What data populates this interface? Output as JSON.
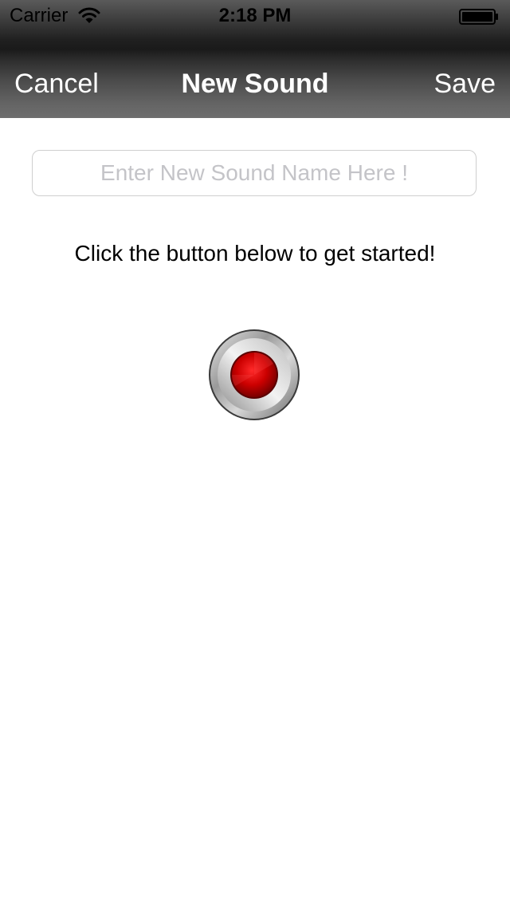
{
  "status_bar": {
    "carrier": "Carrier",
    "time": "2:18 PM",
    "wifi_icon": "wifi-icon",
    "battery_icon": "battery-icon"
  },
  "nav": {
    "cancel_label": "Cancel",
    "title": "New Sound",
    "save_label": "Save"
  },
  "sound_name": {
    "value": "",
    "placeholder": "Enter New Sound Name Here !"
  },
  "instruction": "Click the button below to get started!",
  "record_button": {
    "icon": "record-icon",
    "accent_color": "#cc0000"
  },
  "colors": {
    "nav_text": "#ffffff",
    "background": "#ffffff",
    "placeholder": "#c4c4c8"
  }
}
